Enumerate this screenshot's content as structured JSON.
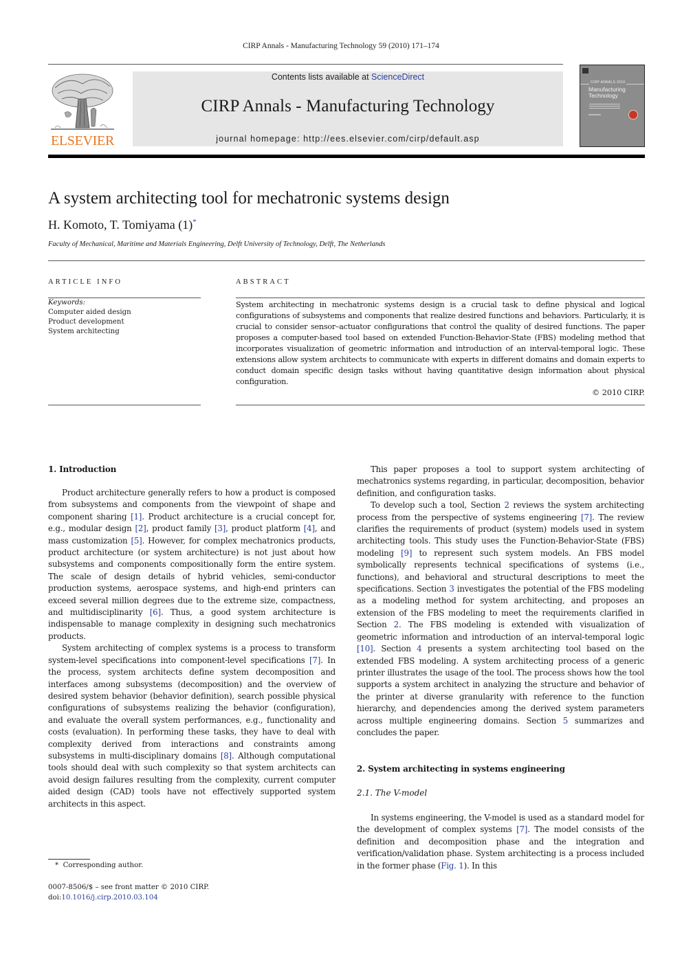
{
  "header": {
    "citation": "CIRP Annals - Manufacturing Technology 59 (2010) 171–174",
    "contents_prefix": "Contents lists available at ",
    "contents_link": "ScienceDirect",
    "journal_title": "CIRP Annals - Manufacturing Technology",
    "homepage": "journal homepage: http://ees.elsevier.com/cirp/default.asp",
    "publisher_logo_text": "ELSEVIER",
    "cover": {
      "small_label": "CIRP ANNALS 2010",
      "title_line1": "Manufacturing",
      "title_line2": "Technology"
    }
  },
  "colors": {
    "link": "#2a3f9e",
    "elsevier_orange": "#e87722",
    "banner_grey": "#e6e6e6"
  },
  "article": {
    "title": "A system architecting tool for mechatronic systems design",
    "authors": "H. Komoto, T. Tomiyama (1)",
    "author_mark": "*",
    "affiliation": "Faculty of Mechanical, Maritime and Materials Engineering, Delft University of Technology, Delft, The Netherlands"
  },
  "article_info": {
    "label": "ARTICLE INFO",
    "keywords_label": "Keywords:",
    "keywords": [
      "Computer aided design",
      "Product development",
      "System architecting"
    ]
  },
  "abstract": {
    "label": "ABSTRACT",
    "text": "System architecting in mechatronic systems design is a crucial task to define physical and logical configurations of subsystems and components that realize desired functions and behaviors. Particularly, it is crucial to consider sensor–actuator configurations that control the quality of desired functions. The paper proposes a computer-based tool based on extended Function-Behavior-State (FBS) modeling method that incorporates visualization of geometric information and introduction of an interval-temporal logic. These extensions allow system architects to communicate with experts in different domains and domain experts to conduct domain specific design tasks without having quantitative design information about physical configuration.",
    "copyright": "© 2010 CIRP."
  },
  "body": {
    "sec1_heading": "1.  Introduction",
    "left": {
      "p1": [
        {
          "t": "Product architecture generally refers to how a product is composed from subsystems and components from the viewpoint of shape and component sharing "
        },
        {
          "r": "[1]"
        },
        {
          "t": ". Product architecture is a crucial concept for, e.g., modular design "
        },
        {
          "r": "[2]"
        },
        {
          "t": ", product family "
        },
        {
          "r": "[3]"
        },
        {
          "t": ", product platform "
        },
        {
          "r": "[4]"
        },
        {
          "t": ", and mass customization "
        },
        {
          "r": "[5]"
        },
        {
          "t": ". However, for complex mechatronics products, product architecture (or system architecture) is not just about how subsystems and components compositionally form the entire system. The scale of design details of hybrid vehicles, semi-conductor production systems, aero­space systems, and high-end printers can exceed several million degrees due to the extreme size, compactness, and multi­disciplinarity "
        },
        {
          "r": "[6]"
        },
        {
          "t": ". Thus, a good system architecture is indispen­sable to manage complexity in designing such mechatronics products."
        }
      ],
      "p2": [
        {
          "t": "System architecting of complex systems is a process to transform system-level specifications into component-level spe­cifications "
        },
        {
          "r": "[7]"
        },
        {
          "t": ". In the process, system architects define system decomposition and interfaces among subsystems (decomposition) and the overview of desired system behavior (behavior definition), search possible physical configurations of subsystems realizing the behavior (configuration), and evaluate the overall system perfor­mances, e.g., functionality and costs (evaluation). In performing these tasks, they have to deal with complexity derived from interactions and constraints among subsystems in multi-disci­plinary domains "
        },
        {
          "r": "[8]"
        },
        {
          "t": ". Although computational tools should deal with such complexity so that system architects can avoid design failures resulting from the complexity, current computer aided design (CAD) tools have not effectively supported system architects in this aspect."
        }
      ]
    },
    "right": {
      "p1": [
        {
          "t": "This paper proposes a tool to support system architecting of mechatronics systems regarding, in particular, decomposition, behavior definition, and configuration tasks."
        }
      ],
      "p2": [
        {
          "t": "To develop such a tool, Section "
        },
        {
          "r": "2"
        },
        {
          "t": " reviews the system architecting process from the perspective of systems engineering "
        },
        {
          "r": "[7]"
        },
        {
          "t": ". The review clarifies the requirements of product (system) models used in system architecting tools. This study uses the Function-Behavior-State (FBS) modeling "
        },
        {
          "r": "[9]"
        },
        {
          "t": " to represent such system models. An FBS model symbolically represents technical specifications of systems (i.e., functions), and behavioral and structural descriptions to meet the specifications. Section "
        },
        {
          "r": "3"
        },
        {
          "t": " investigates the potential of the FBS modeling as a modeling method for system architecting, and proposes an extension of the FBS modeling to meet the requirements clarified in Section "
        },
        {
          "r": "2"
        },
        {
          "t": ". The FBS modeling is extended with visualization of geometric information and introduction of an interval-temporal logic "
        },
        {
          "r": "[10]"
        },
        {
          "t": ". Section "
        },
        {
          "r": "4"
        },
        {
          "t": " presents a system architecting tool based on the extended FBS modeling. A system architecting process of a generic printer illustrates the usage of the tool. The process shows how the tool supports a system architect in analyzing the structure and behavior of the printer at diverse granularity with reference to the function hierarchy, and dependencies among the derived system parameters across multiple engineering domains. Section "
        },
        {
          "r": "5"
        },
        {
          "t": " summarizes and concludes the paper."
        }
      ],
      "sec2_heading": "2.  System architecting in systems engineering",
      "sec21_heading": "2.1.  The V-model",
      "p3": [
        {
          "t": "In systems engineering, the V-model is used as a standard model for the development of complex systems "
        },
        {
          "r": "[7]"
        },
        {
          "t": ". The model consists of the definition and decomposition phase and the integration and verification/validation phase. System architect­ing is a process included in the former phase ("
        },
        {
          "r": "Fig. 1"
        },
        {
          "t": "). In this"
        }
      ]
    }
  },
  "footer": {
    "footnote_mark": "*",
    "footnote": "Corresponding author.",
    "front_matter": "0007-8506/$ – see front matter © 2010 CIRP.",
    "doi_prefix": "doi:",
    "doi": "10.1016/j.cirp.2010.03.104"
  }
}
